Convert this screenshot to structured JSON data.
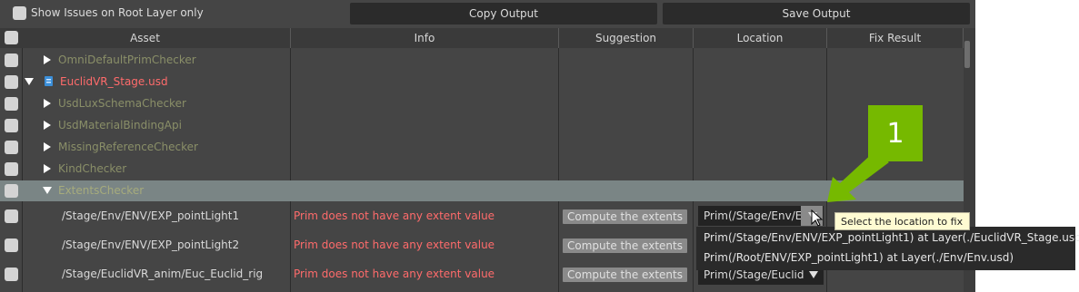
{
  "topbar": {
    "show_issues_label": "Show Issues on Root Layer only",
    "copy_output": "Copy Output",
    "save_output": "Save Output"
  },
  "columns": [
    "Asset",
    "Info",
    "Suggestion",
    "Location",
    "Fix Result"
  ],
  "tree": {
    "omni_checker": "OmniDefaultPrimChecker",
    "stage": "EuclidVR_Stage.usd",
    "checkers": [
      "UsdLuxSchemaChecker",
      "UsdMaterialBindingApi",
      "MissingReferenceChecker",
      "KindChecker"
    ],
    "extents_checker": "ExtentsChecker"
  },
  "issues": [
    {
      "asset": "/Stage/Env/ENV/EXP_pointLight1",
      "info": "Prim does not have any extent value",
      "suggestion": "Compute the extents",
      "location": "Prim(/Stage/Env/EN"
    },
    {
      "asset": "/Stage/Env/ENV/EXP_pointLight2",
      "info": "Prim does not have any extent value",
      "suggestion": "Compute the extents",
      "location": ""
    },
    {
      "asset": "/Stage/EuclidVR_anim/Euc_Euclid_rig",
      "info": "Prim does not have any extent value",
      "suggestion": "Compute the extents",
      "location": "Prim(/Stage/Euclid"
    }
  ],
  "location_options": [
    "Prim(/Stage/Env/ENV/EXP_pointLight1) at Layer(./EuclidVR_Stage.usd)",
    "Prim(/Root/ENV/EXP_pointLight1) at Layer(./Env/Env.usd)"
  ],
  "tooltip": "Select the location to fix",
  "callout_number": "1",
  "colors": {
    "panel_bg": "#454545",
    "error_text": "#ff6b6b",
    "checker_text": "#8a8f68",
    "selected_row": "#7a8585",
    "callout": "#76b900",
    "tooltip_bg": "#fffbd2"
  },
  "icons": [
    "checkbox-icon",
    "expand-arrow-icon",
    "collapse-arrow-icon",
    "usd-file-icon",
    "dropdown-arrow-icon",
    "mouse-cursor-icon"
  ]
}
